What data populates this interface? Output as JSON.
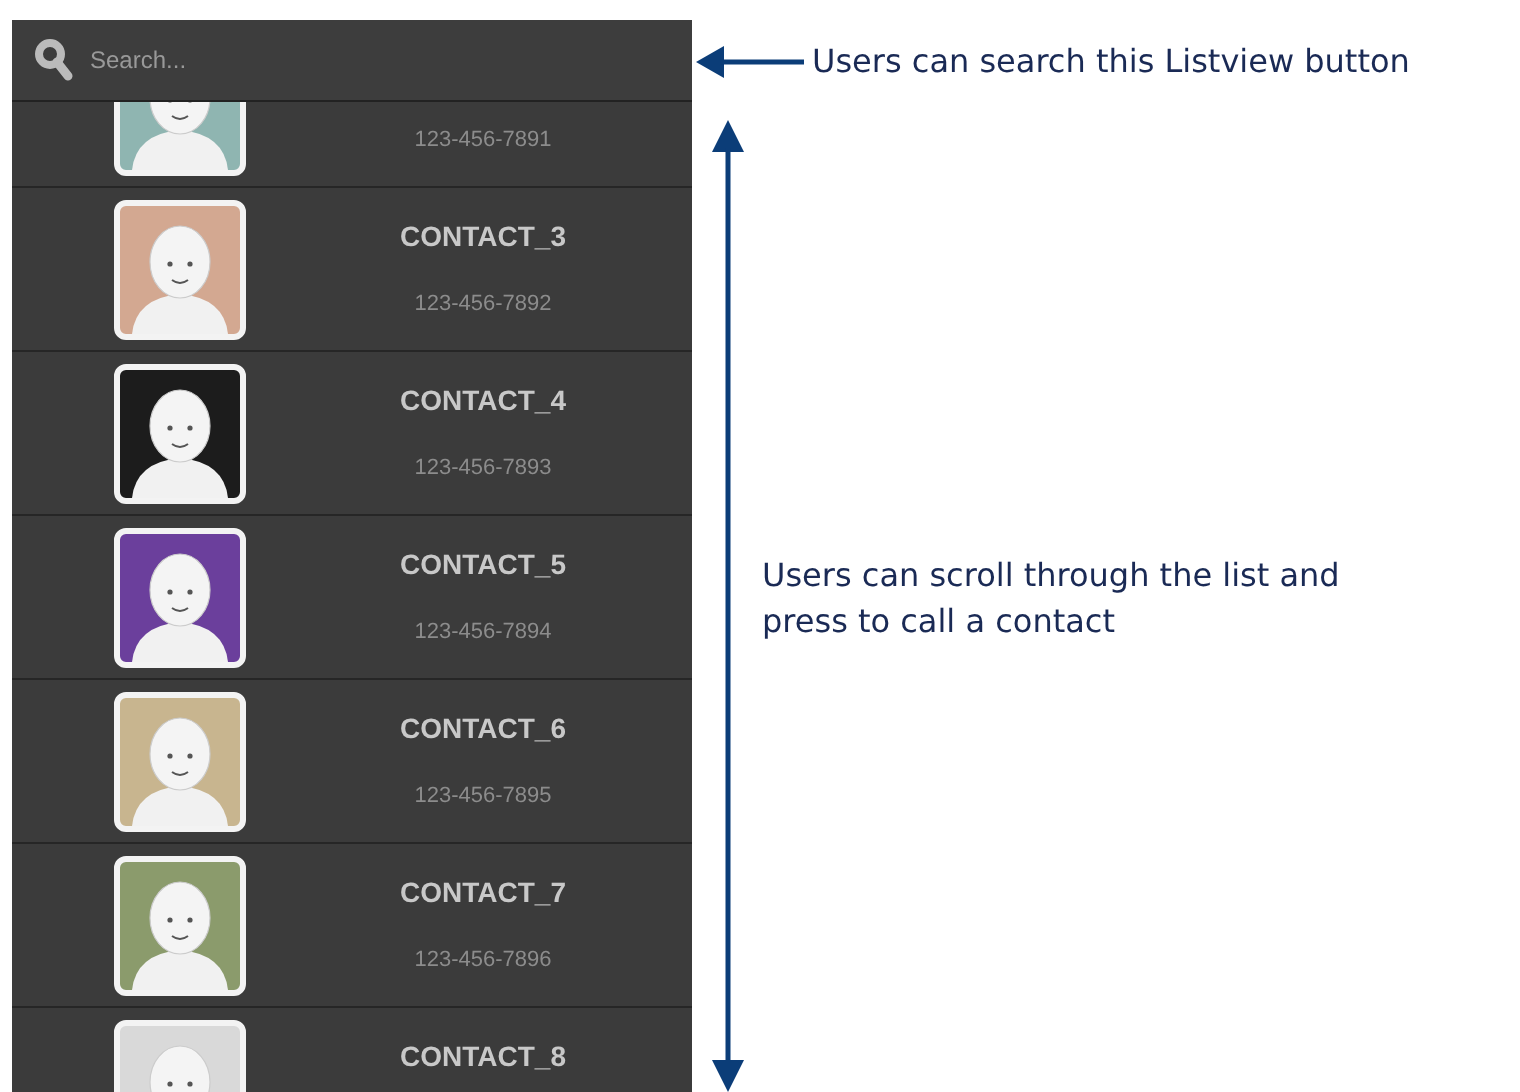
{
  "search": {
    "placeholder": "Search..."
  },
  "contacts": [
    {
      "phone": "123-456-7891",
      "color": "#8fb5b1"
    },
    {
      "name": "CONTACT_3",
      "phone": "123-456-7892",
      "color": "#d3a891"
    },
    {
      "name": "CONTACT_4",
      "phone": "123-456-7893",
      "color": "#1c1c1c"
    },
    {
      "name": "CONTACT_5",
      "phone": "123-456-7894",
      "color": "#6b3f9c"
    },
    {
      "name": "CONTACT_6",
      "phone": "123-456-7895",
      "color": "#c8b58f"
    },
    {
      "name": "CONTACT_7",
      "phone": "123-456-7896",
      "color": "#8b9b6c"
    },
    {
      "name": "CONTACT_8",
      "color": "#d9d9d9"
    }
  ],
  "annotations": {
    "search_note": "Users can search this Listview button",
    "scroll_note": "Users can scroll through the list and press to call a contact"
  }
}
